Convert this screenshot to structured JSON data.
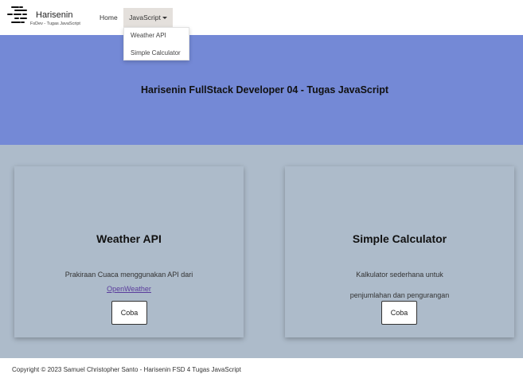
{
  "navbar": {
    "brand_name": "Harisenin",
    "brand_subtitle": "FsDev - Tugas JavaScript",
    "logo_icon": "harisenin-logo-icon",
    "items": [
      {
        "label": "Home"
      },
      {
        "label": "JavaScript",
        "active": true
      }
    ],
    "dropdown": [
      {
        "label": "Weather API"
      },
      {
        "label": "Simple Calculator"
      }
    ]
  },
  "hero": {
    "title": "Harisenin FullStack Developer 04 - Tugas JavaScript",
    "background": "#7489d6"
  },
  "cards": [
    {
      "title": "Weather API",
      "description": "Prakiraan Cuaca menggunakan API dari",
      "link_text": "OpenWeather",
      "button_label": "Coba"
    },
    {
      "title": "Simple Calculator",
      "description": "Kalkulator sederhana untuk penjumlahan dan pengurangan",
      "button_label": "Coba"
    }
  ],
  "footer": {
    "text": "Copyright © 2023 Samuel Christopher Santo - Harisenin FSD 4 Tugas JavaScript"
  },
  "colors": {
    "section_background": "#adbbca",
    "link": "#5a3c9c"
  }
}
